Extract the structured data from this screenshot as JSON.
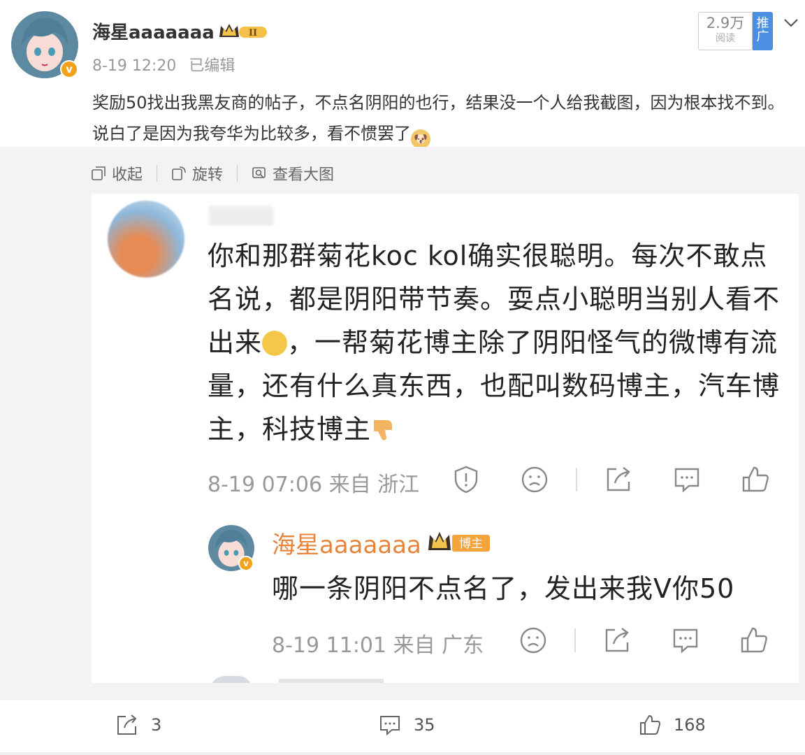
{
  "post": {
    "username": "海星aaaaaaa",
    "level_badge": "II",
    "verified_badge": "v",
    "timestamp": "8-19 12:20",
    "edited": "已编辑",
    "reads": "2.9万",
    "reads_label": "阅读",
    "promote": "推广",
    "text": "奖励50找出我黑友商的帖子，不点名阴阳的也行，结果没一个人给我截图，因为根本找不到。说白了是因为我夸华为比较多，看不惯罢了"
  },
  "toolbar": {
    "collapse": "收起",
    "rotate": "旋转",
    "view_large": "查看大图"
  },
  "screenshot": {
    "comment": {
      "text": "你和那群菊花koc kol确实很聪明。每次不敢点名说，都是阴阳带节奏。耍点小聪明当别人看不出来",
      "text2": "，一帮菊花博主除了阴阳怪气的微博有流量，还有什么真东西，也配叫数码博主，汽车博主，科技博主",
      "meta": "8-19 07:06 来自 浙江"
    },
    "reply": {
      "username": "海星aaaaaaa",
      "tag": "博主",
      "text": "哪一条阴阳不点名了，发出来我V你50",
      "meta": "8-19 11:01 来自 广东"
    }
  },
  "actions": {
    "repost_count": "3",
    "comment_count": "35",
    "like_count": "168"
  }
}
